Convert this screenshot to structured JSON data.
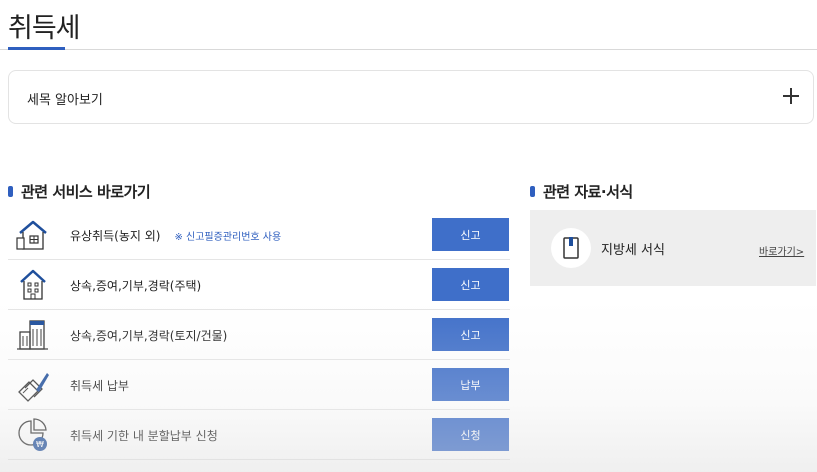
{
  "page": {
    "title": "취득세"
  },
  "tax_info": {
    "label": "세목 알아보기",
    "toggle_icon": "plus-icon"
  },
  "services": {
    "heading": "관련 서비스 바로가기",
    "items": [
      {
        "icon": "house-document-icon",
        "label": "유상취득(농지 외)",
        "note": "※ 신고필증관리번호 사용",
        "button": "신고"
      },
      {
        "icon": "house-icon",
        "label": "상속,증여,기부,경락(주택)",
        "button": "신고"
      },
      {
        "icon": "buildings-icon",
        "label": "상속,증여,기부,경락(토지/건물)",
        "button": "신고"
      },
      {
        "icon": "payment-pen-icon",
        "label": "취득세 납부",
        "button": "납부"
      },
      {
        "icon": "installment-coin-icon",
        "label": "취득세 기한 내 분할납부 신청",
        "button": "신청"
      }
    ]
  },
  "docs": {
    "heading": "관련 자료·서식",
    "card": {
      "icon": "document-icon",
      "label": "지방세 서식",
      "link": "바로가기>"
    }
  },
  "colors": {
    "accent": "#2f5fbf",
    "button": "#3f6fc9",
    "card_bg": "#eeeeee"
  }
}
